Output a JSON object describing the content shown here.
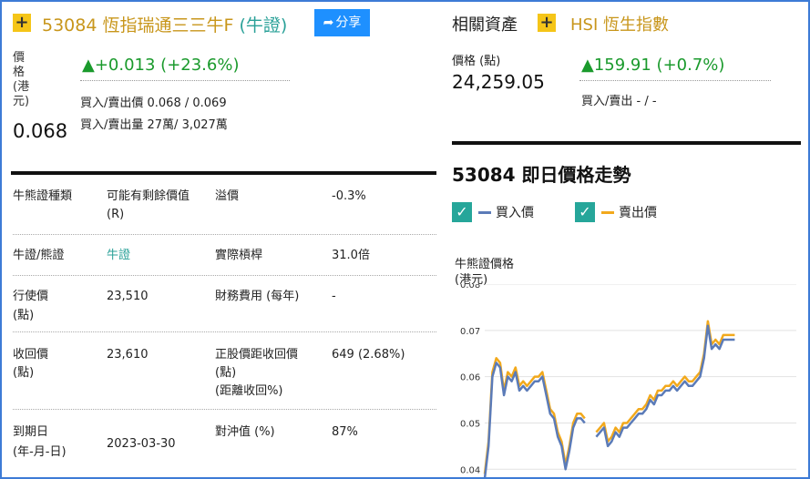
{
  "header": {
    "code_name": "53084 恆指瑞通三三牛F",
    "warrant_type": "(牛證)",
    "share_label": "分享"
  },
  "price": {
    "label": "價格(港元)",
    "label_chars": [
      "價",
      "格",
      "(港",
      "元)"
    ],
    "value": "0.068",
    "change": "+0.013 (+23.6%)",
    "bid_ask_price": "買入/賣出價 0.068 / 0.069",
    "bid_ask_volume": "買入/賣出量 27萬/ 3,027萬"
  },
  "related": {
    "heading": "相關資產",
    "asset_name": "HSI 恆生指數",
    "price_label": "價格 (點)",
    "price_value": "24,259.05",
    "change": "159.91 (+0.7%)",
    "bid_ask": "買入/賣出 - / -"
  },
  "table": {
    "rows": [
      {
        "l1": "牛熊證種類",
        "v1": "可能有剩餘價值",
        "v1b": "(R)",
        "l2": "溢價",
        "v2": "-0.3%"
      },
      {
        "l1": "牛證/熊證",
        "v1": "牛證",
        "l2": "實際槓桿",
        "v2": "31.0倍"
      },
      {
        "l1": "行使價",
        "l1b": "(點)",
        "v1": "23,510",
        "l2": "財務費用 (每年)",
        "v2": "-"
      },
      {
        "l1": "收回價",
        "l1b": "(點)",
        "v1": "23,610",
        "l2": "正股價距收回價",
        "l2b": "(點)",
        "l2c": "(距離收回%)",
        "v2": "649 (2.68%)"
      },
      {
        "l1": "到期日",
        "l1b": "(年-月-日)",
        "v1": "2023-03-30",
        "l2": "對沖值 (%)",
        "v2": "87%"
      }
    ]
  },
  "chart_section": {
    "title": "53084 即日價格走勢",
    "legend_bid": "買入價",
    "legend_ask": "賣出價",
    "y_title_1": "牛熊證價格",
    "y_title_2": "(港元)"
  },
  "colors": {
    "accent_gold": "#c8961b",
    "up_green": "#1a9a2c",
    "bid_line": "#5b7bb8",
    "ask_line": "#f2a91c",
    "check_teal": "#26a69a",
    "share_blue": "#1e90ff"
  },
  "chart_data": {
    "type": "line",
    "yticks": [
      0.08,
      0.07,
      0.06,
      0.05,
      0.04
    ],
    "ylim": [
      0.0375,
      0.08
    ],
    "x": [
      0,
      1,
      2,
      3,
      4,
      5,
      6,
      7,
      8,
      9,
      10,
      11,
      12,
      13,
      14,
      15,
      16,
      17,
      18,
      19,
      20,
      21,
      22,
      23,
      24,
      25,
      26,
      27,
      28,
      29,
      30,
      31,
      32,
      33,
      34,
      35,
      36,
      37,
      38,
      39,
      40,
      41,
      42,
      43,
      44,
      45,
      46,
      47,
      48,
      49,
      50,
      51,
      52,
      53,
      54,
      55,
      56,
      57,
      58,
      59,
      60,
      61,
      62,
      63,
      64,
      65,
      66,
      67,
      68,
      69,
      70,
      71,
      72,
      73,
      74,
      75,
      76,
      77,
      78,
      79,
      80,
      81
    ],
    "series": [
      {
        "name": "買入價",
        "values": [
          0.038,
          0.045,
          0.06,
          0.063,
          0.062,
          0.056,
          0.06,
          0.059,
          0.061,
          0.057,
          0.058,
          0.057,
          0.058,
          0.059,
          0.059,
          0.06,
          0.056,
          0.052,
          0.051,
          0.047,
          0.045,
          0.04,
          0.044,
          0.049,
          0.051,
          0.051,
          0.05,
          null,
          null,
          0.047,
          0.048,
          0.049,
          0.045,
          0.046,
          0.048,
          0.047,
          0.049,
          0.049,
          0.05,
          0.051,
          0.052,
          0.052,
          0.053,
          0.055,
          0.054,
          0.056,
          0.056,
          0.057,
          0.057,
          0.058,
          0.057,
          0.058,
          0.059,
          0.058,
          0.058,
          0.059,
          0.06,
          0.064,
          0.071,
          0.066,
          0.067,
          0.066,
          0.068,
          0.068,
          0.068,
          0.068,
          null,
          null,
          null,
          null,
          null,
          null,
          null,
          null,
          null,
          null,
          null,
          null,
          null,
          null,
          null,
          null
        ]
      },
      {
        "name": "賣出價",
        "values": [
          0.039,
          0.046,
          0.061,
          0.064,
          0.063,
          0.057,
          0.061,
          0.06,
          0.062,
          0.058,
          0.059,
          0.058,
          0.059,
          0.06,
          0.06,
          0.061,
          0.057,
          0.053,
          0.052,
          0.048,
          0.046,
          0.041,
          0.045,
          0.05,
          0.052,
          0.052,
          0.051,
          null,
          null,
          0.048,
          0.049,
          0.05,
          0.046,
          0.047,
          0.049,
          0.048,
          0.05,
          0.05,
          0.051,
          0.052,
          0.053,
          0.053,
          0.054,
          0.056,
          0.055,
          0.057,
          0.057,
          0.058,
          0.058,
          0.059,
          0.058,
          0.059,
          0.06,
          0.059,
          0.059,
          0.06,
          0.061,
          0.065,
          0.072,
          0.067,
          0.068,
          0.067,
          0.069,
          0.069,
          0.069,
          0.069,
          null,
          null,
          null,
          null,
          null,
          null,
          null,
          null,
          null,
          null,
          null,
          null,
          null,
          null,
          null,
          null
        ]
      }
    ]
  }
}
